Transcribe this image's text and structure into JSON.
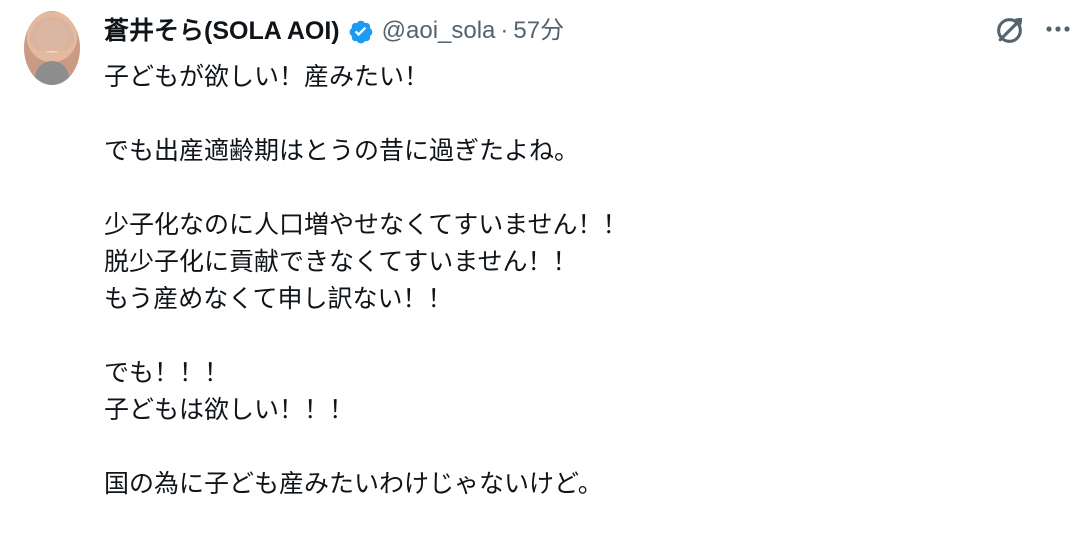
{
  "post": {
    "display_name": "蒼井そら(SOLA AOI)",
    "handle": "@aoi_sola",
    "separator": "·",
    "timestamp": "57分",
    "verified_icon": "verified-badge-icon",
    "grok_icon": "grok-icon",
    "more_icon": "more-options-icon",
    "avatar_alt": "avatar",
    "text_lines": [
      "子どもが欲しい！産みたい！",
      "",
      "でも出産適齢期はとうの昔に過ぎたよね。",
      "",
      "少子化なのに人口増やせなくてすいません！！",
      "脱少子化に貢献できなくてすいません！！",
      "もう産めなくて申し訳ない！！",
      "",
      "でも！！！",
      "子どもは欲しい！！！",
      "",
      "国の為に子ども産みたいわけじゃないけど。"
    ]
  },
  "colors": {
    "text": "#0f1419",
    "secondary_text": "#536471",
    "verified": "#1d9bf0",
    "background": "#ffffff"
  }
}
